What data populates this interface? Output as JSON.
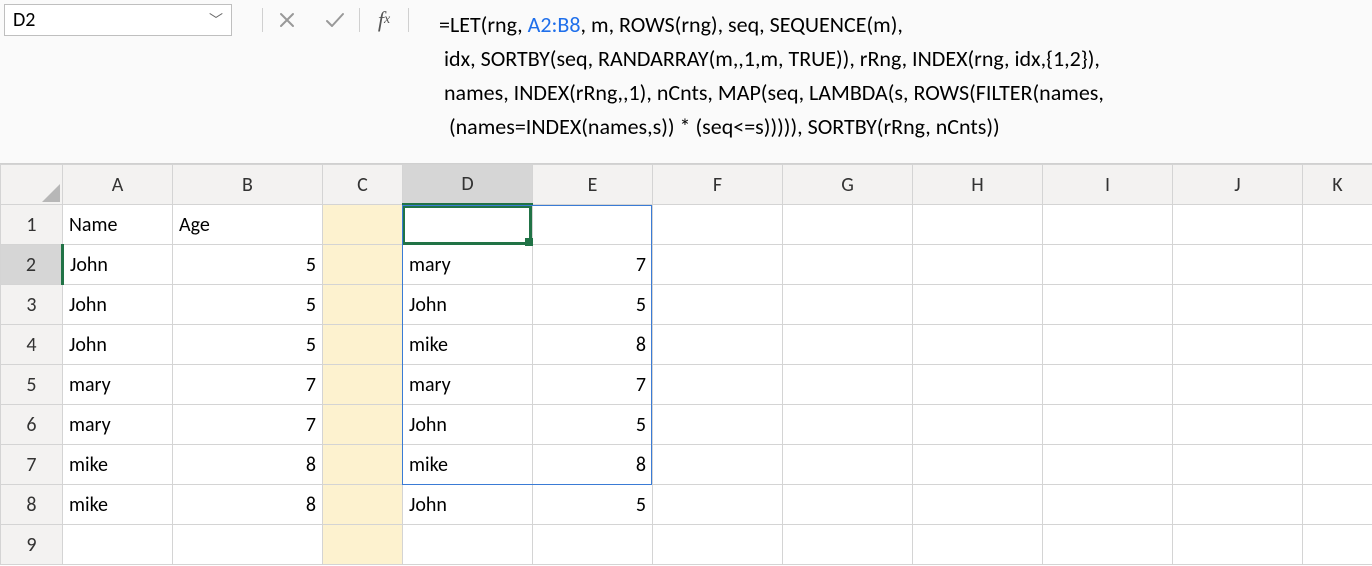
{
  "namebox": {
    "value": "D2"
  },
  "formula": {
    "prefix": "=LET(rng, ",
    "ref": "A2:B8",
    "rest_line1": ", m, ROWS(rng), seq, SEQUENCE(m),",
    "line2": " idx, SORTBY(seq, RANDARRAY(m,,1,m, TRUE)), rRng, INDEX(rng, idx,{1,2}),",
    "line3": " names, INDEX(rRng,,1), nCnts, MAP(seq, LAMBDA(s, ROWS(FILTER(names,",
    "line4": "  (names=INDEX(names,s)) * (seq<=s))))), SORTBY(rRng, nCnts))"
  },
  "columns": [
    "A",
    "B",
    "C",
    "D",
    "E",
    "F",
    "G",
    "H",
    "I",
    "J",
    "K"
  ],
  "rows": [
    "1",
    "2",
    "3",
    "4",
    "5",
    "6",
    "7",
    "8",
    "9"
  ],
  "cells": {
    "A1": "Name",
    "B1": "Age",
    "A2": "John",
    "B2": "5",
    "A3": "John",
    "B3": "5",
    "A4": "John",
    "B4": "5",
    "A5": "mary",
    "B5": "7",
    "A6": "mary",
    "B6": "7",
    "A7": "mike",
    "B7": "8",
    "A8": "mike",
    "B8": "8",
    "D2": "mary",
    "E2": "7",
    "D3": "John",
    "E3": "5",
    "D4": "mike",
    "E4": "8",
    "D5": "mary",
    "E5": "7",
    "D6": "John",
    "E6": "5",
    "D7": "mike",
    "E7": "8",
    "D8": "John",
    "E8": "5"
  }
}
